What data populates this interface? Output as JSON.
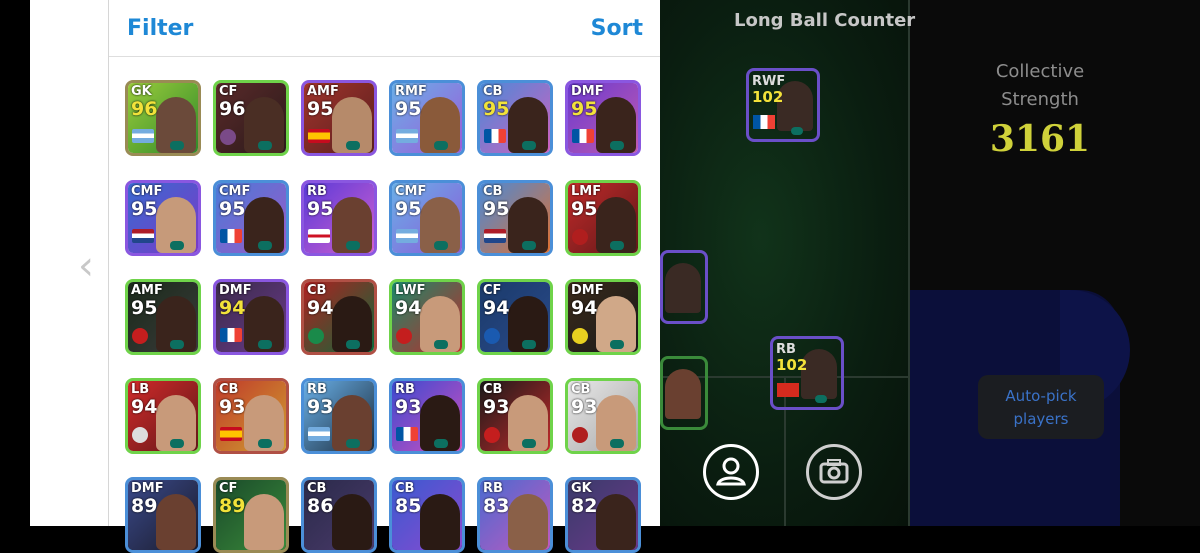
{
  "panel": {
    "filter_label": "Filter",
    "sort_label": "Sort",
    "back_chevron": "‹"
  },
  "formation": {
    "title": "Long Ball Counter",
    "collective_label": "Collective Strength",
    "collective_value": "3161",
    "autopick_label": "Auto-pick players",
    "field_cards": [
      {
        "pos": "RWF",
        "rating": "102"
      },
      {
        "pos": "RB",
        "rating": "102"
      }
    ]
  },
  "icons": {
    "person": "person-icon",
    "camera": "camera-icon",
    "chevron": "chevron-left-icon"
  },
  "players": [
    {
      "pos": "GK",
      "rating": "96",
      "yellow": true
    },
    {
      "pos": "CF",
      "rating": "96",
      "yellow": false
    },
    {
      "pos": "AMF",
      "rating": "95",
      "yellow": false
    },
    {
      "pos": "RMF",
      "rating": "95",
      "yellow": false
    },
    {
      "pos": "CB",
      "rating": "95",
      "yellow": true
    },
    {
      "pos": "DMF",
      "rating": "95",
      "yellow": true
    },
    {
      "pos": "CMF",
      "rating": "95",
      "yellow": false
    },
    {
      "pos": "CMF",
      "rating": "95",
      "yellow": false
    },
    {
      "pos": "RB",
      "rating": "95",
      "yellow": false
    },
    {
      "pos": "CMF",
      "rating": "95",
      "yellow": false
    },
    {
      "pos": "CB",
      "rating": "95",
      "yellow": false
    },
    {
      "pos": "LMF",
      "rating": "95",
      "yellow": false
    },
    {
      "pos": "AMF",
      "rating": "95",
      "yellow": false
    },
    {
      "pos": "DMF",
      "rating": "94",
      "yellow": true
    },
    {
      "pos": "CB",
      "rating": "94",
      "yellow": false
    },
    {
      "pos": "LWF",
      "rating": "94",
      "yellow": false
    },
    {
      "pos": "CF",
      "rating": "94",
      "yellow": false
    },
    {
      "pos": "DMF",
      "rating": "94",
      "yellow": false
    },
    {
      "pos": "LB",
      "rating": "94",
      "yellow": false
    },
    {
      "pos": "CB",
      "rating": "93",
      "yellow": false
    },
    {
      "pos": "RB",
      "rating": "93",
      "yellow": false
    },
    {
      "pos": "RB",
      "rating": "93",
      "yellow": false
    },
    {
      "pos": "CB",
      "rating": "93",
      "yellow": false
    },
    {
      "pos": "CB",
      "rating": "93",
      "yellow": false
    },
    {
      "pos": "DMF",
      "rating": "89",
      "yellow": false
    },
    {
      "pos": "CF",
      "rating": "89",
      "yellow": true
    },
    {
      "pos": "CB",
      "rating": "86",
      "yellow": false
    },
    {
      "pos": "CB",
      "rating": "85",
      "yellow": false
    },
    {
      "pos": "RB",
      "rating": "83",
      "yellow": false
    },
    {
      "pos": "GK",
      "rating": "82",
      "yellow": false
    }
  ]
}
